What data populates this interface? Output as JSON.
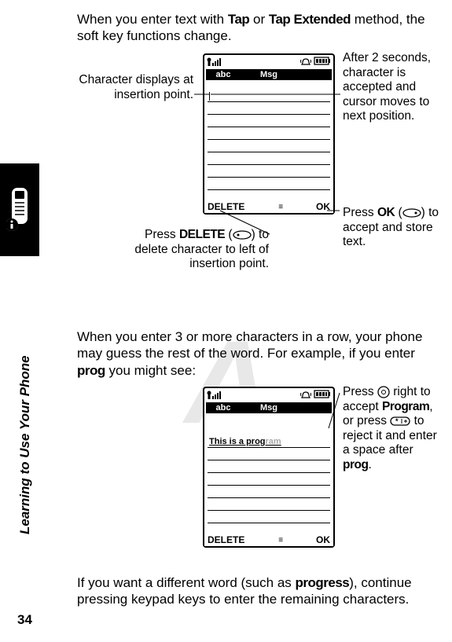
{
  "page_number": "34",
  "section_title": "Learning to Use Your Phone",
  "watermark": "A",
  "paragraphs": {
    "p1_a": "When you enter text with ",
    "p1_b1": "Tap",
    "p1_c": " or ",
    "p1_b2": "Tap Extended",
    "p1_d": " method, the soft key functions change.",
    "p2_a": "When you enter 3 or more characters in a row, your phone may guess the rest of the word. For example, if you enter ",
    "p2_b": "prog",
    "p2_c": " you might see:",
    "p3_a": "If you want a different word (such as ",
    "p3_b": "progress",
    "p3_c": "), continue pressing keypad keys to enter the remaining characters."
  },
  "screen1": {
    "mode": "abc",
    "title": "Msg",
    "delete": "DELETE",
    "ok": "OK"
  },
  "screen2": {
    "mode": "abc",
    "title": "Msg",
    "typed": "This is a prog",
    "predicted": "ram",
    "delete": "DELETE",
    "ok": "OK"
  },
  "callouts": {
    "c1": "Character displays at insertion point.",
    "c2": "After 2 seconds, character is accepted and cursor moves to next position.",
    "c3_a": "Press ",
    "c3_b": "OK",
    "c3_c": " (",
    "c3_d": ") to accept and store text.",
    "c4_a": "Press ",
    "c4_b": "DELETE",
    "c4_c": " (",
    "c4_d": ") to delete character to left of insertion point.",
    "c5_a": "Press ",
    "c5_b": " right to accept ",
    "c5_c": "Program",
    "c5_d": ", or press ",
    "c5_e": " to reject it and enter a space after ",
    "c5_f": "prog",
    "c5_g": "."
  }
}
